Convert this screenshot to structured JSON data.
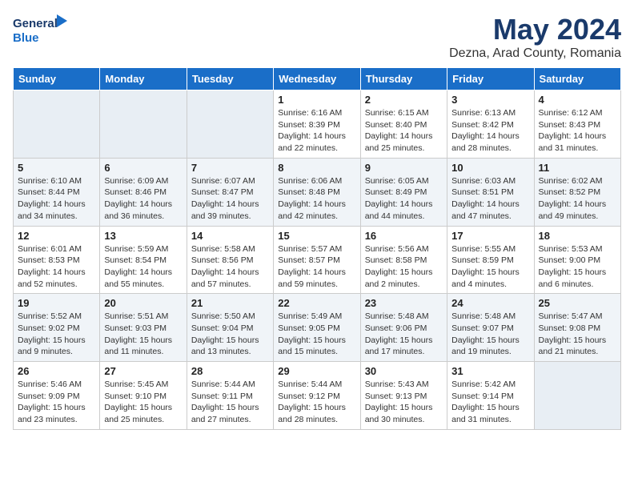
{
  "header": {
    "logo_line1": "General",
    "logo_line2": "Blue",
    "main_title": "May 2024",
    "subtitle": "Dezna, Arad County, Romania"
  },
  "days_of_week": [
    "Sunday",
    "Monday",
    "Tuesday",
    "Wednesday",
    "Thursday",
    "Friday",
    "Saturday"
  ],
  "weeks": [
    [
      {
        "day": "",
        "info": ""
      },
      {
        "day": "",
        "info": ""
      },
      {
        "day": "",
        "info": ""
      },
      {
        "day": "1",
        "info": "Sunrise: 6:16 AM\nSunset: 8:39 PM\nDaylight: 14 hours\nand 22 minutes."
      },
      {
        "day": "2",
        "info": "Sunrise: 6:15 AM\nSunset: 8:40 PM\nDaylight: 14 hours\nand 25 minutes."
      },
      {
        "day": "3",
        "info": "Sunrise: 6:13 AM\nSunset: 8:42 PM\nDaylight: 14 hours\nand 28 minutes."
      },
      {
        "day": "4",
        "info": "Sunrise: 6:12 AM\nSunset: 8:43 PM\nDaylight: 14 hours\nand 31 minutes."
      }
    ],
    [
      {
        "day": "5",
        "info": "Sunrise: 6:10 AM\nSunset: 8:44 PM\nDaylight: 14 hours\nand 34 minutes."
      },
      {
        "day": "6",
        "info": "Sunrise: 6:09 AM\nSunset: 8:46 PM\nDaylight: 14 hours\nand 36 minutes."
      },
      {
        "day": "7",
        "info": "Sunrise: 6:07 AM\nSunset: 8:47 PM\nDaylight: 14 hours\nand 39 minutes."
      },
      {
        "day": "8",
        "info": "Sunrise: 6:06 AM\nSunset: 8:48 PM\nDaylight: 14 hours\nand 42 minutes."
      },
      {
        "day": "9",
        "info": "Sunrise: 6:05 AM\nSunset: 8:49 PM\nDaylight: 14 hours\nand 44 minutes."
      },
      {
        "day": "10",
        "info": "Sunrise: 6:03 AM\nSunset: 8:51 PM\nDaylight: 14 hours\nand 47 minutes."
      },
      {
        "day": "11",
        "info": "Sunrise: 6:02 AM\nSunset: 8:52 PM\nDaylight: 14 hours\nand 49 minutes."
      }
    ],
    [
      {
        "day": "12",
        "info": "Sunrise: 6:01 AM\nSunset: 8:53 PM\nDaylight: 14 hours\nand 52 minutes."
      },
      {
        "day": "13",
        "info": "Sunrise: 5:59 AM\nSunset: 8:54 PM\nDaylight: 14 hours\nand 55 minutes."
      },
      {
        "day": "14",
        "info": "Sunrise: 5:58 AM\nSunset: 8:56 PM\nDaylight: 14 hours\nand 57 minutes."
      },
      {
        "day": "15",
        "info": "Sunrise: 5:57 AM\nSunset: 8:57 PM\nDaylight: 14 hours\nand 59 minutes."
      },
      {
        "day": "16",
        "info": "Sunrise: 5:56 AM\nSunset: 8:58 PM\nDaylight: 15 hours\nand 2 minutes."
      },
      {
        "day": "17",
        "info": "Sunrise: 5:55 AM\nSunset: 8:59 PM\nDaylight: 15 hours\nand 4 minutes."
      },
      {
        "day": "18",
        "info": "Sunrise: 5:53 AM\nSunset: 9:00 PM\nDaylight: 15 hours\nand 6 minutes."
      }
    ],
    [
      {
        "day": "19",
        "info": "Sunrise: 5:52 AM\nSunset: 9:02 PM\nDaylight: 15 hours\nand 9 minutes."
      },
      {
        "day": "20",
        "info": "Sunrise: 5:51 AM\nSunset: 9:03 PM\nDaylight: 15 hours\nand 11 minutes."
      },
      {
        "day": "21",
        "info": "Sunrise: 5:50 AM\nSunset: 9:04 PM\nDaylight: 15 hours\nand 13 minutes."
      },
      {
        "day": "22",
        "info": "Sunrise: 5:49 AM\nSunset: 9:05 PM\nDaylight: 15 hours\nand 15 minutes."
      },
      {
        "day": "23",
        "info": "Sunrise: 5:48 AM\nSunset: 9:06 PM\nDaylight: 15 hours\nand 17 minutes."
      },
      {
        "day": "24",
        "info": "Sunrise: 5:48 AM\nSunset: 9:07 PM\nDaylight: 15 hours\nand 19 minutes."
      },
      {
        "day": "25",
        "info": "Sunrise: 5:47 AM\nSunset: 9:08 PM\nDaylight: 15 hours\nand 21 minutes."
      }
    ],
    [
      {
        "day": "26",
        "info": "Sunrise: 5:46 AM\nSunset: 9:09 PM\nDaylight: 15 hours\nand 23 minutes."
      },
      {
        "day": "27",
        "info": "Sunrise: 5:45 AM\nSunset: 9:10 PM\nDaylight: 15 hours\nand 25 minutes."
      },
      {
        "day": "28",
        "info": "Sunrise: 5:44 AM\nSunset: 9:11 PM\nDaylight: 15 hours\nand 27 minutes."
      },
      {
        "day": "29",
        "info": "Sunrise: 5:44 AM\nSunset: 9:12 PM\nDaylight: 15 hours\nand 28 minutes."
      },
      {
        "day": "30",
        "info": "Sunrise: 5:43 AM\nSunset: 9:13 PM\nDaylight: 15 hours\nand 30 minutes."
      },
      {
        "day": "31",
        "info": "Sunrise: 5:42 AM\nSunset: 9:14 PM\nDaylight: 15 hours\nand 31 minutes."
      },
      {
        "day": "",
        "info": ""
      }
    ]
  ]
}
